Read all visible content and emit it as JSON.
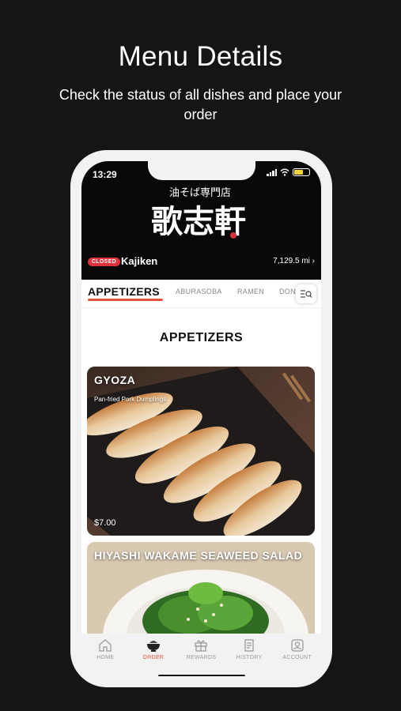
{
  "promo": {
    "title": "Menu Details",
    "subtitle": "Check the status of all dishes and place your order"
  },
  "status_bar": {
    "time": "13:29"
  },
  "store": {
    "status_badge": "CLOSED",
    "name": "Kajiken",
    "distance": "7,129.5 mi"
  },
  "category_tabs": [
    {
      "label": "APPETIZERS",
      "active": true
    },
    {
      "label": "ABURASOBA",
      "active": false
    },
    {
      "label": "RAMEN",
      "active": false
    },
    {
      "label": "DON",
      "active": false
    }
  ],
  "section": {
    "title": "APPETIZERS"
  },
  "menu_items": [
    {
      "name": "GYOZA",
      "description": "Pan-fried Pork Dumplings",
      "price": "$7.00"
    },
    {
      "name": "HIYASHI WAKAME SEAWEED SALAD"
    }
  ],
  "bottom_nav": [
    {
      "label": "HOME",
      "icon": "home-icon",
      "active": false
    },
    {
      "label": "ORDER",
      "icon": "bowl-icon",
      "active": true
    },
    {
      "label": "REWARDS",
      "icon": "gift-icon",
      "active": false
    },
    {
      "label": "HISTORY",
      "icon": "receipt-icon",
      "active": false
    },
    {
      "label": "ACCOUNT",
      "icon": "account-icon",
      "active": false
    }
  ],
  "colors": {
    "accent": "#e0533a",
    "closed_badge": "#e0323a",
    "background": "#151515",
    "header": "#080808"
  }
}
